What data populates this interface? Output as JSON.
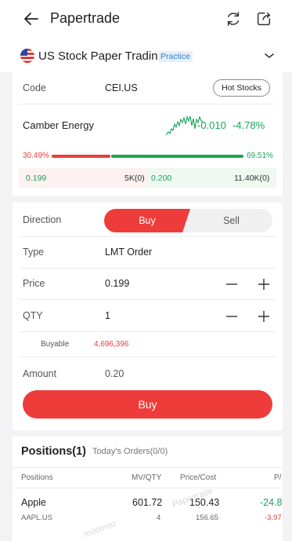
{
  "header": {
    "title": "Papertrade",
    "back_icon": "back-arrow-icon",
    "refresh_icon": "refresh-icon",
    "share_icon": "share-icon"
  },
  "account": {
    "name": "US Stock Paper Trading",
    "badge": "Practice",
    "flag_icon": "us-flag-icon",
    "chevron_icon": "chevron-down-icon"
  },
  "quote": {
    "code_label": "Code",
    "code": "CEI.US",
    "hot_stocks": "Hot Stocks",
    "name": "Camber Energy",
    "change": "-0.010",
    "change_pct": "-4.78%",
    "bid_pct": "30.49%",
    "ask_pct": "69.51%",
    "bid_ratio": 0.3049,
    "bid_price": "0.199",
    "bid_size": "5K(0)",
    "ask_price": "0.200",
    "ask_size": "11.40K(0)"
  },
  "order": {
    "direction_label": "Direction",
    "buy_tab": "Buy",
    "sell_tab": "Sell",
    "type_label": "Type",
    "type_value": "LMT Order",
    "price_label": "Price",
    "price_value": "0.199",
    "qty_label": "QTY",
    "qty_value": "1",
    "buyable_label": "Buyable",
    "buyable_value": "4,696,396",
    "amount_label": "Amount",
    "amount_value": "0.20",
    "submit": "Buy"
  },
  "positions": {
    "title": "Positions(1)",
    "orders_tab": "Today's Orders(0/0)",
    "columns": [
      "Positions",
      "MV/QTY",
      "Price/Cost",
      "P/"
    ],
    "rows": [
      {
        "name": "Apple",
        "symbol": "AAPL.US",
        "mv": "601.72",
        "qty": "4",
        "price": "150.43",
        "cost": "156.65",
        "pl": "-24.8",
        "pl_pct": "-3.97"
      }
    ]
  },
  "watermark": [
    "moomoo",
    "Papertrade"
  ],
  "colors": {
    "red": "#ee3c3a",
    "green": "#1aa35a",
    "accent_blue": "#2f7bd6"
  }
}
